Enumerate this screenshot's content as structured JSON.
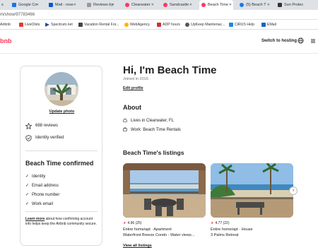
{
  "browser": {
    "tabs": [
      {
        "label": "s",
        "color": "#888888"
      },
      {
        "label": "Google Co",
        "color": "#1a73e8"
      },
      {
        "label": "Mail - rese",
        "color": "#0b57d0"
      },
      {
        "label": "Reviews by",
        "color": "#999999"
      },
      {
        "label": "Clearwater",
        "color": "#ff385c"
      },
      {
        "label": "Sandcastle",
        "color": "#ff385c"
      },
      {
        "label": "Beach Time",
        "color": "#ff385c"
      },
      {
        "label": "(5) Beach T",
        "color": "#1877f2"
      },
      {
        "label": "Sun Protec",
        "color": "#333333"
      }
    ],
    "url": "m/show/97783466",
    "bookmarks": [
      {
        "label": "Airbnb",
        "color": "#ff385c"
      },
      {
        "label": "LiveOlsts",
        "color": "#e53935"
      },
      {
        "label": "Spectrum.net",
        "color": "#1f4e9e"
      },
      {
        "label": "Vacation Rental For...",
        "color": "#444444"
      },
      {
        "label": "WebAgency",
        "color": "#ffb300"
      },
      {
        "label": "ADP hours",
        "color": "#d32f2f"
      },
      {
        "label": "UpKeep Maintenac...",
        "color": "#555555"
      },
      {
        "label": "CiRUS Help",
        "color": "#1e88e5"
      },
      {
        "label": "EMail",
        "color": "#1565c0"
      }
    ]
  },
  "site": {
    "logo": "bnb",
    "switch_to_hosting": "Switch to hosting"
  },
  "profile_card": {
    "update_photo": "Update photo",
    "reviews": "688 reviews",
    "identity_verified": "Identity verified",
    "confirmed_title": "Beach Time confirmed",
    "confirmed_items": [
      "Identity",
      "Email address",
      "Phone number",
      "Work email"
    ],
    "learn_more": "Learn more",
    "learn_text": "about how confirming account info helps keep the Airbnb community secure."
  },
  "main": {
    "greeting": "Hi, I'm Beach Time",
    "joined": "Joined in 2016",
    "edit_profile": "Edit profile",
    "about_title": "About",
    "lives_in": "Lives in Clearwater, FL",
    "work": "Work: Beach Time Rentals",
    "listings_title": "Beach Time's listings",
    "listings": [
      {
        "rating": "4.96",
        "count": "(25)",
        "type": "Entire home/apt · Apartment",
        "title": "Waterfront Breeze Condo - Water views..."
      },
      {
        "rating": "4.77",
        "count": "(22)",
        "type": "Entire home/apt · House",
        "title": "3 Palms Retreat"
      }
    ],
    "view_all": "View all listings"
  },
  "colors": {
    "brand": "#ff385c"
  }
}
